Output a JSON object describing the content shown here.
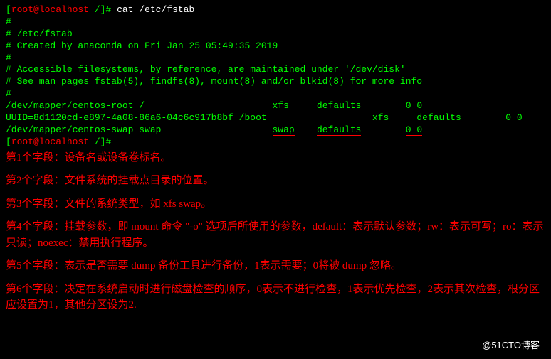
{
  "prompt": {
    "open": "[",
    "user": "root@localhost",
    "path": " /",
    "close": "]#",
    "command": "cat /etc/fstab"
  },
  "fstab": {
    "comments": [
      "#",
      "# /etc/fstab",
      "# Created by anaconda on Fri Jan 25 05:49:35 2019",
      "#",
      "# Accessible filesystems, by reference, are maintained under '/dev/disk'",
      "# See man pages fstab(5), findfs(8), mount(8) and/or blkid(8) for more info",
      "#"
    ],
    "entries": [
      {
        "device": "/dev/mapper/centos-root",
        "mount": "/",
        "type": "xfs",
        "options": "defaults",
        "dump": "0",
        "pass": "0",
        "highlight": false
      },
      {
        "device": "UUID=8d1120cd-e897-4a08-86a6-04c6c917b8bf",
        "mount": "/boot",
        "type": "xfs",
        "options": "defaults",
        "dump": "0",
        "pass": "0",
        "highlight": false
      },
      {
        "device": "/dev/mapper/centos-swap",
        "mount": "swap",
        "type": "swap",
        "options": "defaults",
        "dump": "0",
        "pass": "0",
        "highlight": true
      }
    ]
  },
  "prompt2": {
    "open": "[",
    "user": "root@localhost",
    "path": " /",
    "close": "]#"
  },
  "annotations": [
    "第1个字段：设备名或设备卷标名。",
    "第2个字段：文件系统的挂载点目录的位置。",
    "第3个字段：文件的系统类型，如 xfs  swap。",
    "第4个字段：挂载参数，即 mount 命令 \"-o\" 选项后所使用的参数，default：表示默认参数；rw：表示可写；ro：表示只读；noexec：禁用执行程序。",
    "第5个字段：表示是否需要 dump 备份工具进行备份，1表示需要；0将被 dump 忽略。",
    "第6个字段：决定在系统启动时进行磁盘检查的顺序，0表示不进行检查，1表示优先检查，2表示其次检查，根分区应设置为1，其他分区设为2."
  ],
  "watermark": "@51CTO博客"
}
